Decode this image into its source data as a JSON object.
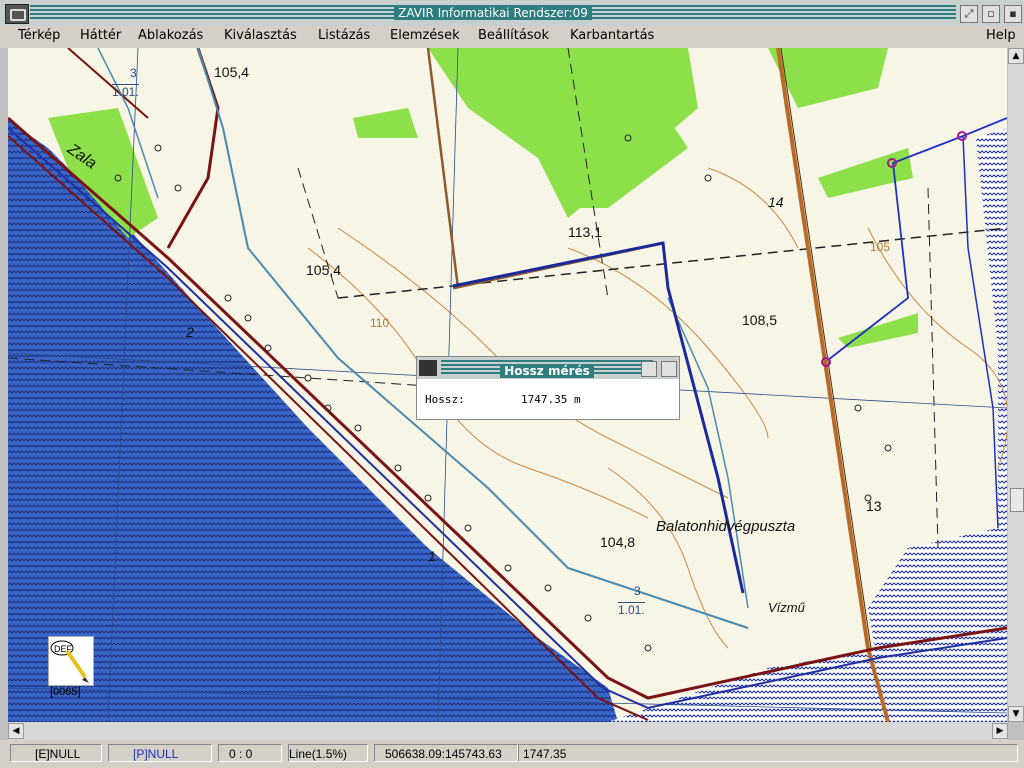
{
  "window": {
    "title": "ZAVIR Informatikai Rendszer:09"
  },
  "menu": {
    "items": [
      "Térkép",
      "Háttér",
      "Ablakozás",
      "Kiválasztás",
      "Listázás",
      "Elemzések",
      "Beállítások",
      "Karbantartás"
    ],
    "help": "Help"
  },
  "map": {
    "labels": {
      "zala": "Zala",
      "h1054a": "105,4",
      "h1054b": "105,4",
      "h1131": "113,1",
      "h1085": "108,5",
      "h1048": "104,8",
      "n14": "14",
      "n13": "13",
      "n2": "2",
      "n1": "1",
      "place": "Balatonhidvégpuszta",
      "vizmu": "Vízmű",
      "c110": "110",
      "c105": "105",
      "frac_top_num": "3",
      "frac_top_den": "1.01.",
      "frac_bot_num": "3",
      "frac_bot_den": "1.01."
    },
    "colors": {
      "water": "#2b5ec7",
      "forest": "#8ee04a",
      "road": "#8b1a1a",
      "measure": "#1a2a9a"
    }
  },
  "dialog": {
    "title": "Hossz mérés",
    "label": "Hossz:",
    "value": "1747.35 m"
  },
  "def_tool": {
    "icon_text": "DEF",
    "code": "[0065]"
  },
  "status": {
    "e": "[E]NULL",
    "p": "[P]NULL",
    "zero": "0 : 0",
    "line": "Line(1.5%)",
    "coords": "506638.09:145743.63",
    "length": "1747.35"
  }
}
